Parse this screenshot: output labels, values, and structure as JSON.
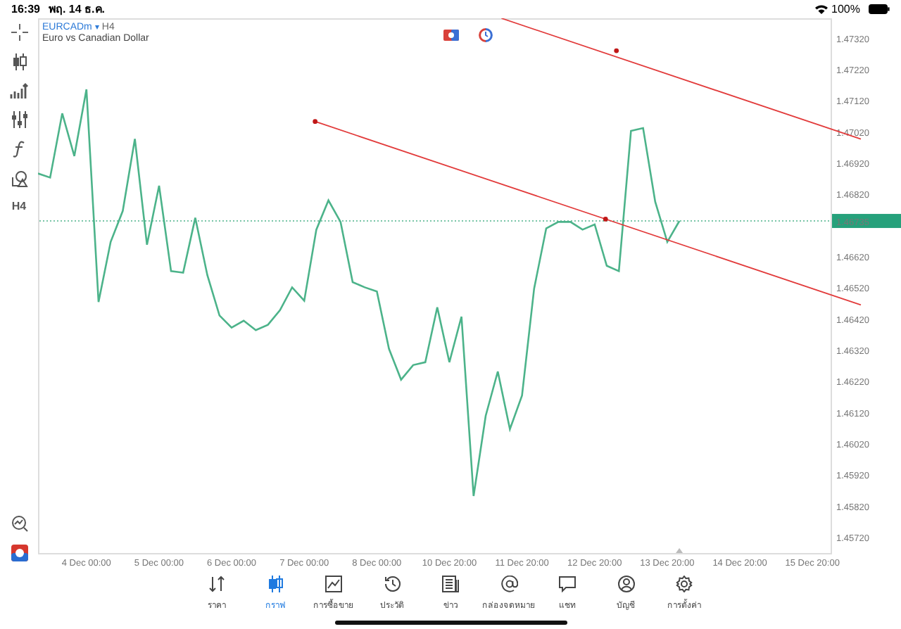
{
  "status_bar": {
    "time": "16:39",
    "date": "พฤ. 14 ธ.ค.",
    "battery": "100%"
  },
  "symbol": {
    "name": "EURCADm",
    "caret": "▾",
    "timeframe": "H4",
    "description": "Euro vs Canadian Dollar"
  },
  "toolbar": {
    "timeframe": "H4"
  },
  "chart": {
    "current_price": "1.46735",
    "chart_data": {
      "type": "line",
      "categories": [
        null,
        null,
        null,
        null,
        "4 Dec 00:00",
        null,
        null,
        null,
        null,
        null,
        "5 Dec 00:00",
        null,
        null,
        null,
        null,
        null,
        "6 Dec 00:00",
        null,
        null,
        null,
        null,
        null,
        "7 Dec 00:00",
        null,
        null,
        null,
        null,
        null,
        "8 Dec 00:00",
        null,
        null,
        null,
        null,
        null,
        "10 Dec 20:00",
        null,
        null,
        null,
        null,
        null,
        "11 Dec 20:00",
        null,
        null,
        null,
        null,
        null,
        "12 Dec 20:00",
        null,
        null,
        null,
        null,
        null,
        "13 Dec 20:00",
        null,
        null,
        null,
        null,
        null,
        "14 Dec 20:00",
        null,
        null,
        null,
        null,
        null,
        "15 Dec 20:00",
        null
      ],
      "series": [
        {
          "color": "#4cb38a",
          "values": [
            1.46887,
            1.46874,
            1.4708,
            1.46943,
            1.47157,
            1.46475,
            1.46668,
            1.46767,
            1.46998,
            1.46659,
            1.46848,
            1.46574,
            1.46569,
            1.46745,
            1.46561,
            1.46432,
            1.46393,
            1.46415,
            1.46385,
            1.46402,
            1.46449,
            1.46522,
            1.46479,
            1.46707,
            1.46801,
            1.46732,
            1.46539,
            1.46522,
            1.46509,
            1.46325,
            1.46226,
            1.46273,
            1.46282,
            1.46458,
            1.46282,
            1.46428,
            1.45853,
            1.4611,
            1.46252,
            1.46067,
            1.46175,
            1.46518,
            1.46711,
            1.46732,
            1.46732,
            1.46707,
            1.46724,
            1.46591,
            1.46574,
            1.47024,
            1.47033,
            1.46797,
            1.46668,
            1.46735,
            null,
            null,
            null,
            null,
            null,
            null,
            null,
            null,
            null,
            null,
            null,
            null
          ]
        }
      ],
      "ylim": [
        1.4567,
        1.47385
      ],
      "yticks": [
        {
          "value": 1.4732,
          "label": "1.47320"
        },
        {
          "value": 1.4722,
          "label": "1.47220"
        },
        {
          "value": 1.4712,
          "label": "1.47120"
        },
        {
          "value": 1.4702,
          "label": "1.47020"
        },
        {
          "value": 1.4692,
          "label": "1.46920"
        },
        {
          "value": 1.4682,
          "label": "1.46820"
        },
        {
          "value": 1.4662,
          "label": "1.46620"
        },
        {
          "value": 1.4652,
          "label": "1.46520"
        },
        {
          "value": 1.4642,
          "label": "1.46420"
        },
        {
          "value": 1.4632,
          "label": "1.46320"
        },
        {
          "value": 1.4622,
          "label": "1.46220"
        },
        {
          "value": 1.4612,
          "label": "1.46120"
        },
        {
          "value": 1.4602,
          "label": "1.46020"
        },
        {
          "value": 1.4592,
          "label": "1.45920"
        },
        {
          "value": 1.4582,
          "label": "1.45820"
        },
        {
          "value": 1.4572,
          "label": "1.45720"
        }
      ]
    }
  },
  "tabs": [
    {
      "label": "ราคา",
      "selected": false
    },
    {
      "label": "กราฟ",
      "selected": true
    },
    {
      "label": "การซื้อขาย",
      "selected": false
    },
    {
      "label": "ประวัติ",
      "selected": false
    },
    {
      "label": "ข่าว",
      "selected": false
    },
    {
      "label": "กล่องจดหมาย",
      "selected": false
    },
    {
      "label": "แชท",
      "selected": false
    },
    {
      "label": "บัญชี",
      "selected": false
    },
    {
      "label": "การตั้งค่า",
      "selected": false
    }
  ]
}
